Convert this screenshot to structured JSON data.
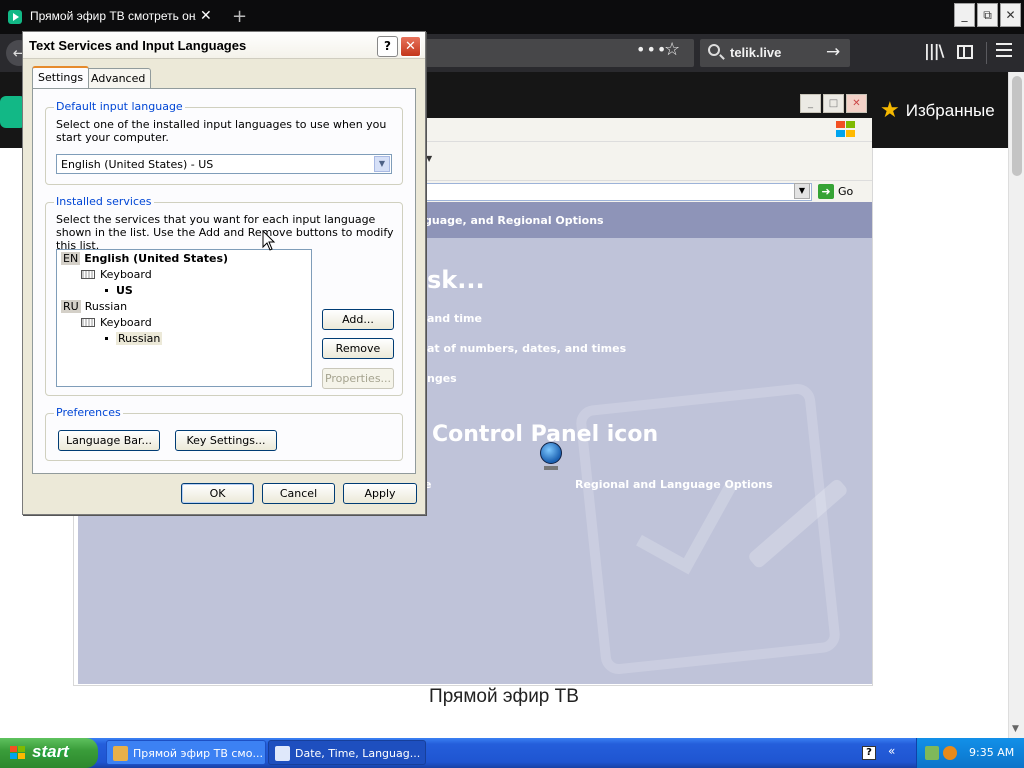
{
  "browser": {
    "tab_title": "Прямой эфир ТВ смотреть онлай",
    "tab_close": "✕",
    "new_tab": "+",
    "window_buttons": [
      "_",
      "⧉",
      "✕"
    ],
    "search_text": "telik.live",
    "dots": "•••"
  },
  "site": {
    "favorites_label": "Избранные",
    "video_caption": "Прямой эфир ТВ"
  },
  "control_panel": {
    "go_label": "Go",
    "breadcrumb": "guage, and Regional Options",
    "task_heading": "sk...",
    "links": [
      "and time",
      "at of numbers, dates, and times",
      "nges"
    ],
    "icon_heading": "Control Panel icon",
    "icon_link_left": "e",
    "icon_link_regional": "Regional and Language Options"
  },
  "dialog": {
    "title": "Text Services and Input Languages",
    "help_button": "?",
    "close_button": "✕",
    "tabs": [
      "Settings",
      "Advanced"
    ],
    "default_group": {
      "legend": "Default input language",
      "description": "Select one of the installed input languages to use when you start your computer.",
      "selected_value": "English (United States) - US"
    },
    "installed_group": {
      "legend": "Installed services",
      "description": "Select the services that you want for each input language shown in the list. Use the Add and Remove buttons to modify this list.",
      "tree": [
        {
          "code": "EN",
          "name": "English (United States)",
          "category": "Keyboard",
          "layout": "US"
        },
        {
          "code": "RU",
          "name": "Russian",
          "category": "Keyboard",
          "layout": "Russian"
        }
      ],
      "add_button": "Add...",
      "remove_button": "Remove",
      "properties_button": "Properties..."
    },
    "preferences_group": {
      "legend": "Preferences",
      "language_bar_button": "Language Bar...",
      "key_settings_button": "Key Settings..."
    },
    "ok_button": "OK",
    "cancel_button": "Cancel",
    "apply_button": "Apply"
  },
  "taskbar": {
    "start_label": "start",
    "tasks": [
      "Прямой эфир ТВ смо...",
      "Date, Time, Languag..."
    ],
    "help_icon": "?",
    "chevron": "«",
    "clock": "9:35 AM"
  },
  "colors": {
    "firefox_dark": "#0c0c0d",
    "firefox_toolbar": "#2a2a2e",
    "site_accent": "#12b886",
    "xp_taskbar_blue": "#245edb",
    "xp_start_green": "#3a9d3a",
    "xp_dialog_face": "#ece9d8",
    "xp_group_legend": "#0046d5"
  }
}
